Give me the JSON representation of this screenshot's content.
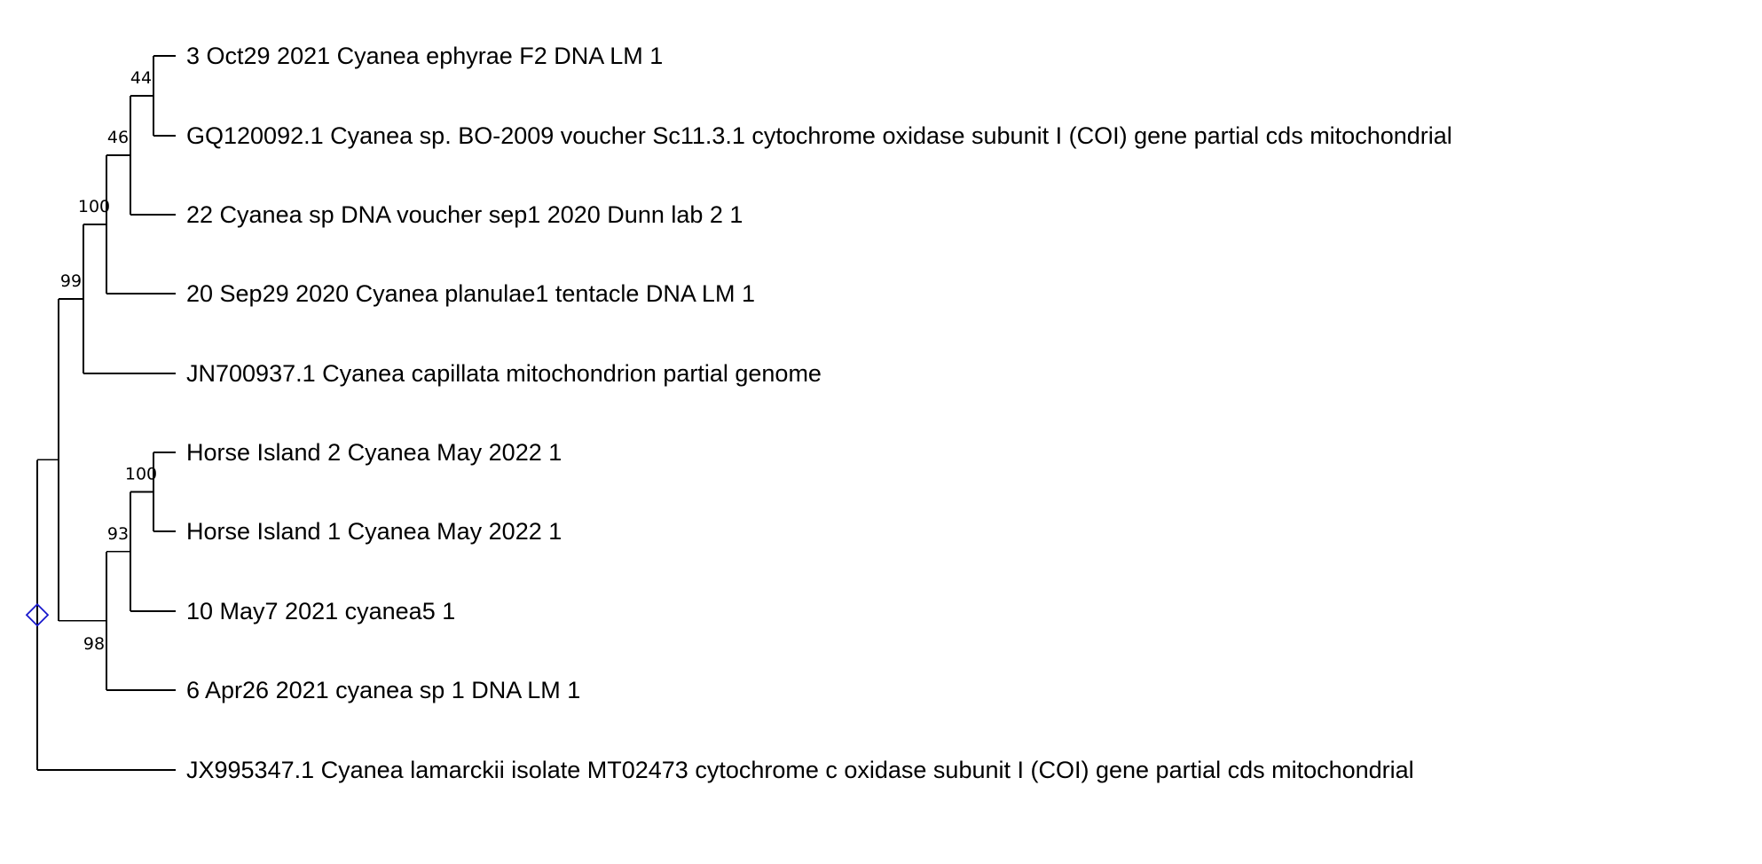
{
  "tree": {
    "root_marker_color": "#1a1acc",
    "branch_color": "#000000",
    "taxa": [
      {
        "id": "t1",
        "label": "3 Oct29 2021 Cyanea ephyrae F2 DNA LM 1"
      },
      {
        "id": "t2",
        "label": "GQ120092.1 Cyanea sp. BO-2009 voucher Sc11.3.1 cytochrome oxidase subunit I (COI) gene partial cds mitochondrial"
      },
      {
        "id": "t3",
        "label": "22 Cyanea sp DNA voucher sep1 2020 Dunn lab 2 1"
      },
      {
        "id": "t4",
        "label": "20 Sep29 2020 Cyanea planulae1 tentacle DNA LM 1"
      },
      {
        "id": "t5",
        "label": "JN700937.1 Cyanea capillata mitochondrion partial genome"
      },
      {
        "id": "t6",
        "label": "Horse Island 2 Cyanea May 2022 1"
      },
      {
        "id": "t7",
        "label": "Horse Island 1 Cyanea May 2022 1"
      },
      {
        "id": "t8",
        "label": "10 May7 2021 cyanea5 1"
      },
      {
        "id": "t9",
        "label": "6 Apr26 2021 cyanea sp 1 DNA LM 1"
      },
      {
        "id": "t10",
        "label": "JX995347.1 Cyanea lamarckii isolate MT02473 cytochrome c oxidase subunit I (COI) gene partial cds mitochondrial"
      }
    ],
    "support_values": [
      {
        "node": "n_t1_t2",
        "value": "44"
      },
      {
        "node": "n_t1_t3",
        "value": "46"
      },
      {
        "node": "n_t1_t4",
        "value": "100"
      },
      {
        "node": "n_t1_t5",
        "value": "99"
      },
      {
        "node": "n_t6_t7",
        "value": "100"
      },
      {
        "node": "n_t6_t8",
        "value": "93"
      },
      {
        "node": "n_t6_t9",
        "value": "98"
      }
    ]
  }
}
